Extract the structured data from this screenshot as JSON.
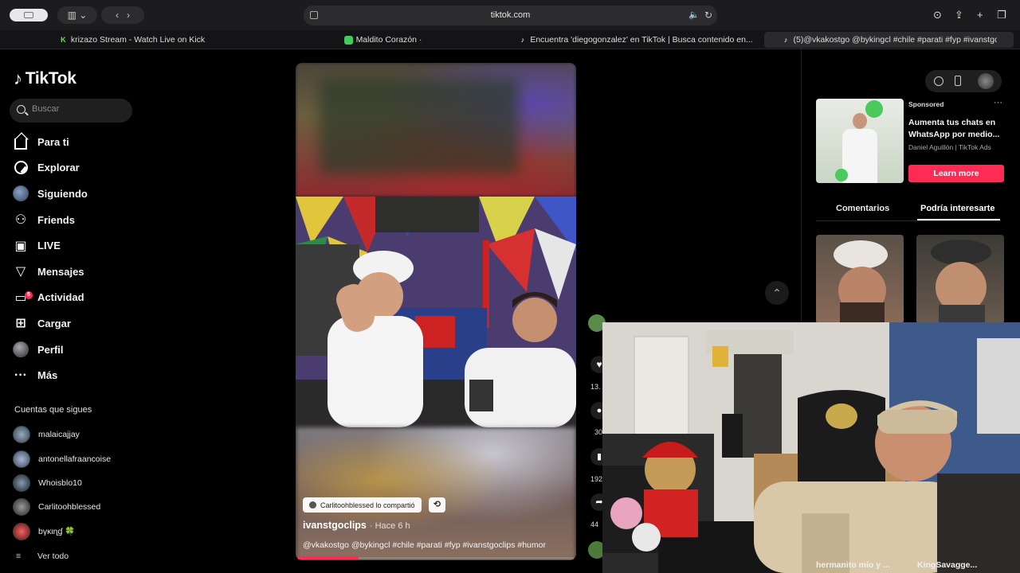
{
  "browser": {
    "url": "tiktok.com",
    "tabs": [
      {
        "label": "krizazo Stream - Watch Live on Kick",
        "favicon": "kick-icon",
        "color": "#53fc18"
      },
      {
        "label": "Maldito Corazón ·",
        "favicon": "app-icon",
        "color": "#3fce5e"
      },
      {
        "label": "Encuentra 'diegogonzalez' en TikTok | Busca contenido en...",
        "favicon": "tiktok-icon",
        "color": "#ffffff"
      },
      {
        "label": "(5)@vkakostgo @bykingcl #chile #parati #fyp #ivanstgo...",
        "favicon": "tiktok-icon",
        "color": "#ffffff"
      }
    ]
  },
  "sidebar": {
    "logo": "TikTok",
    "search_placeholder": "Buscar",
    "nav": [
      {
        "label": "Para ti",
        "icon": "home-icon"
      },
      {
        "label": "Explorar",
        "icon": "compass-icon"
      },
      {
        "label": "Siguiendo",
        "icon": "avatar-icon"
      },
      {
        "label": "Friends",
        "icon": "friends-icon"
      },
      {
        "label": "LIVE",
        "icon": "live-icon"
      },
      {
        "label": "Mensajes",
        "icon": "messages-icon"
      },
      {
        "label": "Actividad",
        "icon": "activity-icon",
        "badge": "5"
      },
      {
        "label": "Cargar",
        "icon": "upload-icon"
      },
      {
        "label": "Perfil",
        "icon": "profile-avatar-icon"
      },
      {
        "label": "Más",
        "icon": "more-icon"
      }
    ],
    "following_title": "Cuentas que sigues",
    "following": [
      {
        "name": "malaicajjay",
        "color": "#6a86a8"
      },
      {
        "name": "antonellafraancoise",
        "color": "#7c8fb1"
      },
      {
        "name": "Whoisblo10",
        "color": "#3c4a5d"
      },
      {
        "name": "Carlitoohblessed",
        "color": "#5b5b5b"
      },
      {
        "name": "bγκιɳɠ 🍀",
        "color": "#b33030"
      }
    ],
    "see_all": "Ver todo"
  },
  "video": {
    "shared_by": "Carlitoohblessed lo compartió",
    "author": "ivanstgoclips",
    "time": "· Hace 6 h",
    "caption": "@vkakostgo @bykingcl #chile #parati #fyp #ivanstgoclips #humor",
    "progress": 0.22
  },
  "actions": {
    "likes": "13.",
    "comments": "30",
    "saves": "192",
    "shares": "44"
  },
  "right_panel": {
    "ad": {
      "sponsored": "Sponsored",
      "title": "Aumenta tus chats en WhatsApp por medio...",
      "sub": "Daniel Aguillón | TikTok Ads",
      "cta": "Learn more"
    },
    "tabs": [
      "Comentarios",
      "Podría interesarte"
    ],
    "active_tab": "Podría interesarte"
  },
  "stream_labels": [
    "hermanito mío y ...",
    "KingSavagge..."
  ],
  "colors": {
    "accent": "#fe2c55",
    "background": "#000000"
  }
}
